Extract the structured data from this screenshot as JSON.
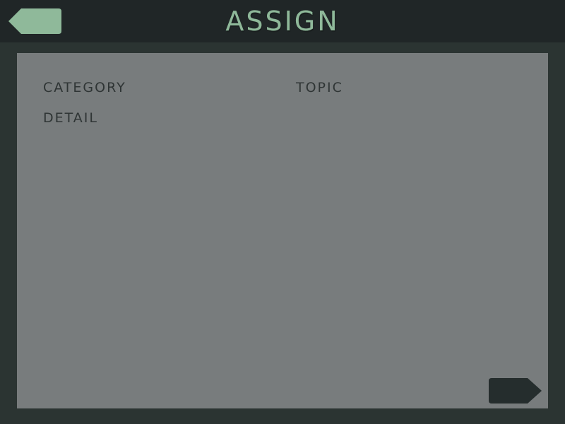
{
  "header": {
    "title": "ASSIGN",
    "back_icon": "back-arrow-icon"
  },
  "panel": {
    "fields": {
      "category": "CATEGORY",
      "topic": "TOPIC",
      "detail": "DETAIL"
    }
  },
  "footer": {
    "next_icon": "next-arrow-icon"
  },
  "colors": {
    "background": "#2b3432",
    "header": "#202627",
    "accent": "#8fb99a",
    "panel": "#787c7d",
    "label_text": "#2f3535",
    "next_button": "#252d2d"
  }
}
